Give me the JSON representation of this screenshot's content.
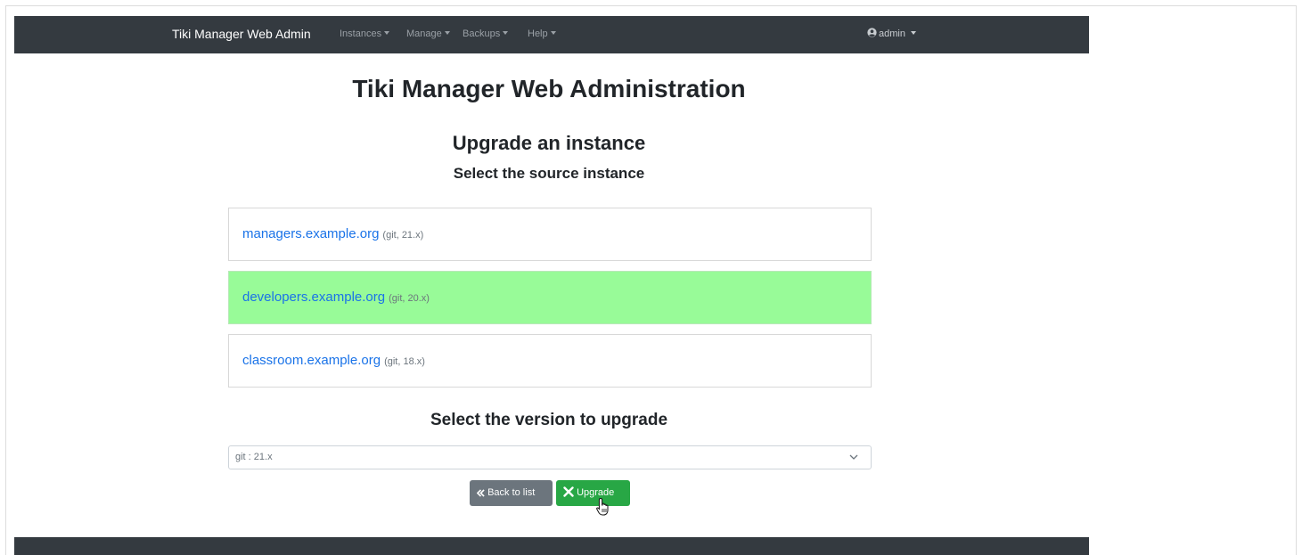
{
  "navbar": {
    "brand": "Tiki Manager Web Admin",
    "menu": [
      {
        "label": "Instances"
      },
      {
        "label": "Manage"
      },
      {
        "label": "Backups"
      },
      {
        "label": "Help"
      }
    ],
    "user": {
      "label": "admin",
      "icon": "user-circle-icon"
    }
  },
  "page": {
    "title": "Tiki Manager Web Administration",
    "heading": "Upgrade an instance",
    "subheading": "Select the source instance",
    "version_heading": "Select the version to upgrade"
  },
  "instances": [
    {
      "name": "managers.example.org",
      "meta": "(git, 21.x)",
      "selected": false
    },
    {
      "name": "developers.example.org",
      "meta": "(git, 20.x)",
      "selected": true
    },
    {
      "name": "classroom.example.org",
      "meta": "(git, 18.x)",
      "selected": false
    }
  ],
  "version_select": {
    "value": "git : 21.x",
    "icon": "chevron-down-icon"
  },
  "buttons": {
    "back": {
      "label": "Back to list",
      "icon": "double-chevron-left-icon"
    },
    "upgrade": {
      "label": "Upgrade",
      "icon": "tools-icon"
    }
  },
  "colors": {
    "navbar": "#343a40",
    "selected_row": "#98fb98",
    "link": "#1a73e8",
    "back_button": "#6c757d",
    "upgrade_button": "#28a745"
  }
}
